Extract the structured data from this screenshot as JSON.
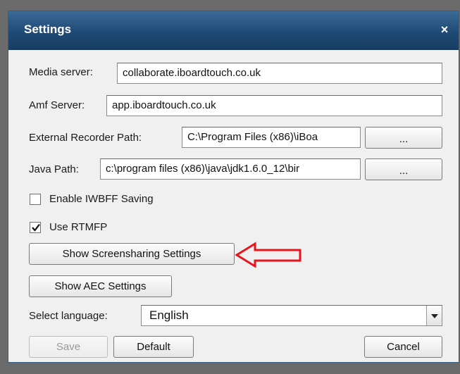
{
  "dialog": {
    "title": "Settings",
    "close_symbol": "×"
  },
  "fields": {
    "media_server": {
      "label": "Media server:",
      "value": "collaborate.iboardtouch.co.uk"
    },
    "amf_server": {
      "label": "Amf Server:",
      "value": "app.iboardtouch.co.uk"
    },
    "external_recorder_path": {
      "label": "External Recorder Path:",
      "value": "C:\\Program Files (x86)\\iBoa",
      "browse_label": "..."
    },
    "java_path": {
      "label": "Java Path:",
      "value": "c:\\program files (x86)\\java\\jdk1.6.0_12\\bir",
      "browse_label": "..."
    }
  },
  "checkboxes": {
    "enable_iwbff_saving": {
      "label": "Enable IWBFF Saving",
      "checked": false
    },
    "use_rtmfp": {
      "label": "Use RTMFP",
      "checked": true
    }
  },
  "buttons": {
    "screensharing": "Show Screensharing Settings",
    "aec": "Show AEC Settings",
    "save": "Save",
    "default": "Default",
    "cancel": "Cancel"
  },
  "language": {
    "label": "Select language:",
    "selected": "English"
  },
  "colors": {
    "annotation_arrow": "#e8141b",
    "titlebar": "#1f4a75"
  },
  "icons": {
    "close": "close-icon",
    "check": "checkmark-icon",
    "dropdown": "chevron-down-icon",
    "annotation": "arrow-left-icon"
  }
}
